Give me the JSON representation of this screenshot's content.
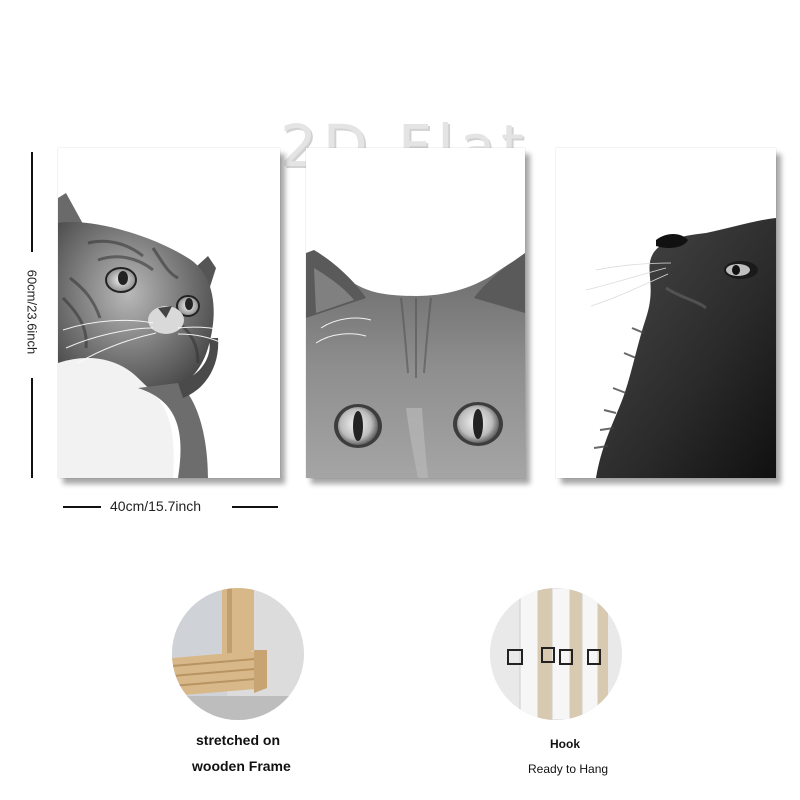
{
  "watermark": "2D Flat",
  "dimensions": {
    "height_label": "60cm/23.6inch",
    "width_label": "40cm/15.7inch"
  },
  "panels": [
    {
      "subject": "cat looking up to the right, tabby, black and white"
    },
    {
      "subject": "grey cat face peeking up from bottom edge"
    },
    {
      "subject": "dark long-haired cat looking up to the left"
    }
  ],
  "features": {
    "frame": {
      "line1": "stretched on",
      "line2": "wooden Frame"
    },
    "hook": {
      "line1": "Hook",
      "line2": "Ready to Hang"
    }
  },
  "colors": {
    "frame_wood": "#d8b888",
    "dimension_lines": "#111111"
  }
}
